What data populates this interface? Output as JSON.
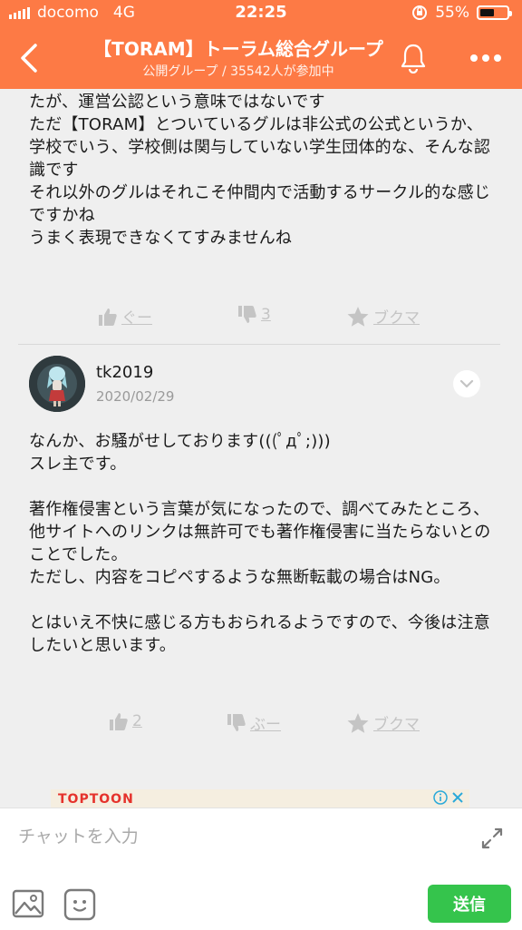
{
  "status_bar": {
    "carrier": "docomo",
    "network": "4G",
    "time": "22:25",
    "battery_percent": "55%",
    "battery_level": 0.55
  },
  "nav": {
    "title": "【TORAM】トーラム総合グループ",
    "subtitle": "公開グループ / 35542人が参加中"
  },
  "messages": [
    {
      "text": "たが、運営公認という意味ではないです\nただ【TORAM】とついているグルは非公式の公式というか、\n学校でいう、学校側は関与していない学生団体的な、そんな認識です\nそれ以外のグルはそれこそ仲間内で活動するサークル的な感じですかね\nうまく表現できなくてすみませんね",
      "reactions": {
        "like": "ぐー",
        "dislike": "3",
        "bookmark": "ブクマ"
      }
    },
    {
      "author": "tk2019",
      "date": "2020/02/29",
      "text": "なんか、お騒がせしております(((ﾟдﾟ;)))\nスレ主です。\n\n著作権侵害という言葉が気になったので、調べてみたところ、他サイトへのリンクは無許可でも著作権侵害に当たらないとのことでした。\nただし、内容をコピペするような無断転載の場合はNG。\n\nとはいえ不快に感じる方もおられるようですので、今後は注意したいと思います。",
      "reactions": {
        "like": "2",
        "dislike": "ぶー",
        "bookmark": "ブクマ"
      }
    }
  ],
  "ad": {
    "logo": "TOPTOON"
  },
  "input": {
    "placeholder": "チャットを入力",
    "send_label": "送信"
  },
  "colors": {
    "header": "#fd7a45",
    "background": "#efefef",
    "reaction_gray": "#c4c4c4",
    "send_green": "#35c44c"
  },
  "icons": [
    "back-arrow-icon",
    "bell-icon",
    "more-dots-icon",
    "thumbs-up-icon",
    "thumbs-down-icon",
    "star-icon",
    "chevron-down-icon",
    "expand-icon",
    "image-icon",
    "sticker-icon"
  ]
}
